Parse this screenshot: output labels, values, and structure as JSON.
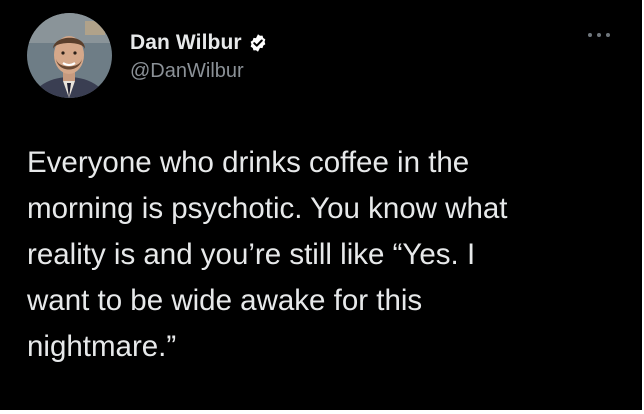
{
  "author": {
    "display_name": "Dan Wilbur",
    "handle": "@DanWilbur",
    "verified": true
  },
  "tweet": {
    "text": "Everyone who drinks coffee in the\nmorning is psychotic. You know what\nreality is and you’re still like “Yes. I\nwant to be wide awake for this\nnightmare.”"
  },
  "icons": {
    "avatar": "profile-photo",
    "verified": "verified-badge-icon",
    "more": "more-options-icon"
  },
  "colors": {
    "background": "#000000",
    "text": "#e7e9ea",
    "secondary_text": "#8b9197",
    "badge": "#ffffff"
  }
}
